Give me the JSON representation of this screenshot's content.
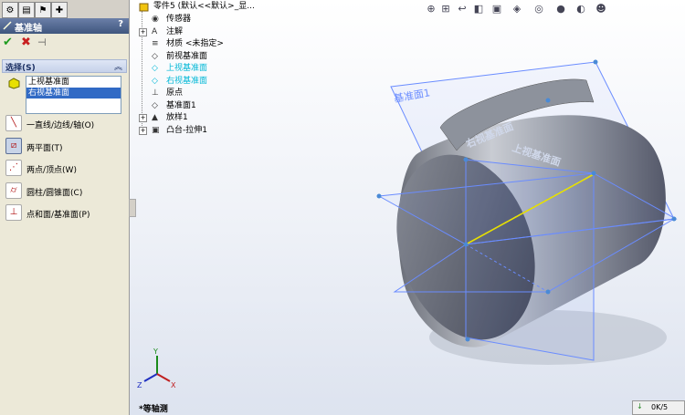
{
  "property_manager": {
    "title": "基准轴",
    "help": "?",
    "section_label": "选择(S)",
    "selections": [
      "上视基准面",
      "右视基准面"
    ],
    "options": [
      {
        "label": "一直线/边线/轴(O)",
        "icon": "line-icon",
        "pressed": false
      },
      {
        "label": "两平面(T)",
        "icon": "two-planes-icon",
        "pressed": true
      },
      {
        "label": "两点/顶点(W)",
        "icon": "two-points-icon",
        "pressed": false
      },
      {
        "label": "圆柱/圆锥面(C)",
        "icon": "cylinder-icon",
        "pressed": false
      },
      {
        "label": "点和面/基准面(P)",
        "icon": "point-plane-icon",
        "pressed": false
      }
    ]
  },
  "feature_tree": {
    "root": "零件5  (默认<<默认>_显...",
    "items": [
      {
        "label": "传感器",
        "icon": "sensor-icon",
        "expand": "",
        "highlight": false
      },
      {
        "label": "注解",
        "icon": "annotation-icon",
        "expand": "+",
        "highlight": false
      },
      {
        "label": "材质 <未指定>",
        "icon": "material-icon",
        "expand": "",
        "highlight": false
      },
      {
        "label": "前视基准面",
        "icon": "plane-icon",
        "expand": "",
        "highlight": false
      },
      {
        "label": "上视基准面",
        "icon": "plane-icon",
        "expand": "",
        "highlight": true
      },
      {
        "label": "右视基准面",
        "icon": "plane-icon",
        "expand": "",
        "highlight": true
      },
      {
        "label": "原点",
        "icon": "origin-icon",
        "expand": "",
        "highlight": false
      },
      {
        "label": "基准面1",
        "icon": "plane-icon",
        "expand": "",
        "highlight": false
      },
      {
        "label": "放样1",
        "icon": "loft-icon",
        "expand": "+",
        "highlight": false
      },
      {
        "label": "凸台-拉伸1",
        "icon": "extrude-icon",
        "expand": "+",
        "highlight": false
      }
    ]
  },
  "viewport": {
    "plane_label": "基准面1",
    "face_label_1": "右视基准面",
    "face_label_2": "上视基准面",
    "view_name": "*等轴测"
  },
  "status": {
    "text": "0K/5"
  },
  "colors": {
    "accent": "#316ac5",
    "plane": "#6a8cff",
    "axis": "#e8e000",
    "title": "#3f567e"
  }
}
